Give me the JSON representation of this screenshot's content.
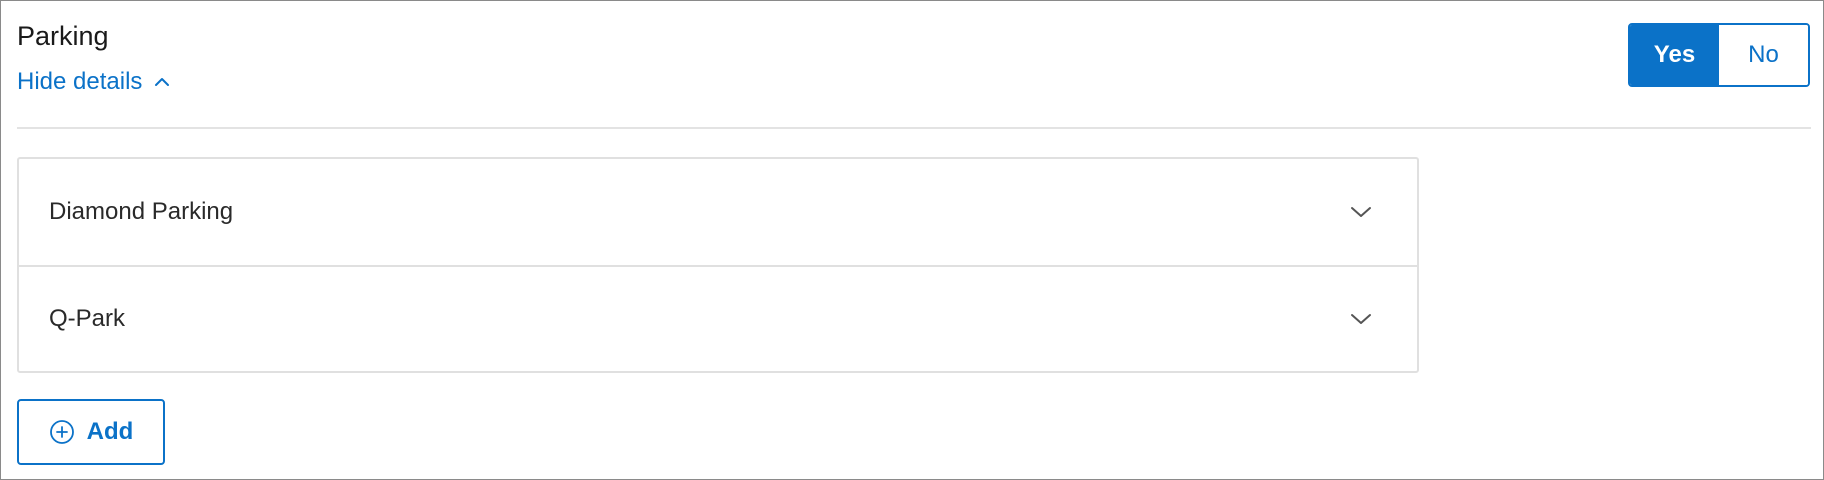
{
  "section": {
    "title": "Parking",
    "hide_details_label": "Hide details"
  },
  "toggle": {
    "yes_label": "Yes",
    "no_label": "No",
    "selected": "Yes"
  },
  "parking_list": {
    "items": [
      {
        "label": "Diamond Parking"
      },
      {
        "label": "Q-Park"
      }
    ]
  },
  "add_button": {
    "label": "Add"
  },
  "colors": {
    "accent": "#0b72c8",
    "border": "#e0e0e0",
    "text": "#1a1a1a"
  },
  "icons": {
    "hide_details": "chevron-up-icon",
    "expand": "chevron-down-icon",
    "add": "plus-circle-icon"
  }
}
